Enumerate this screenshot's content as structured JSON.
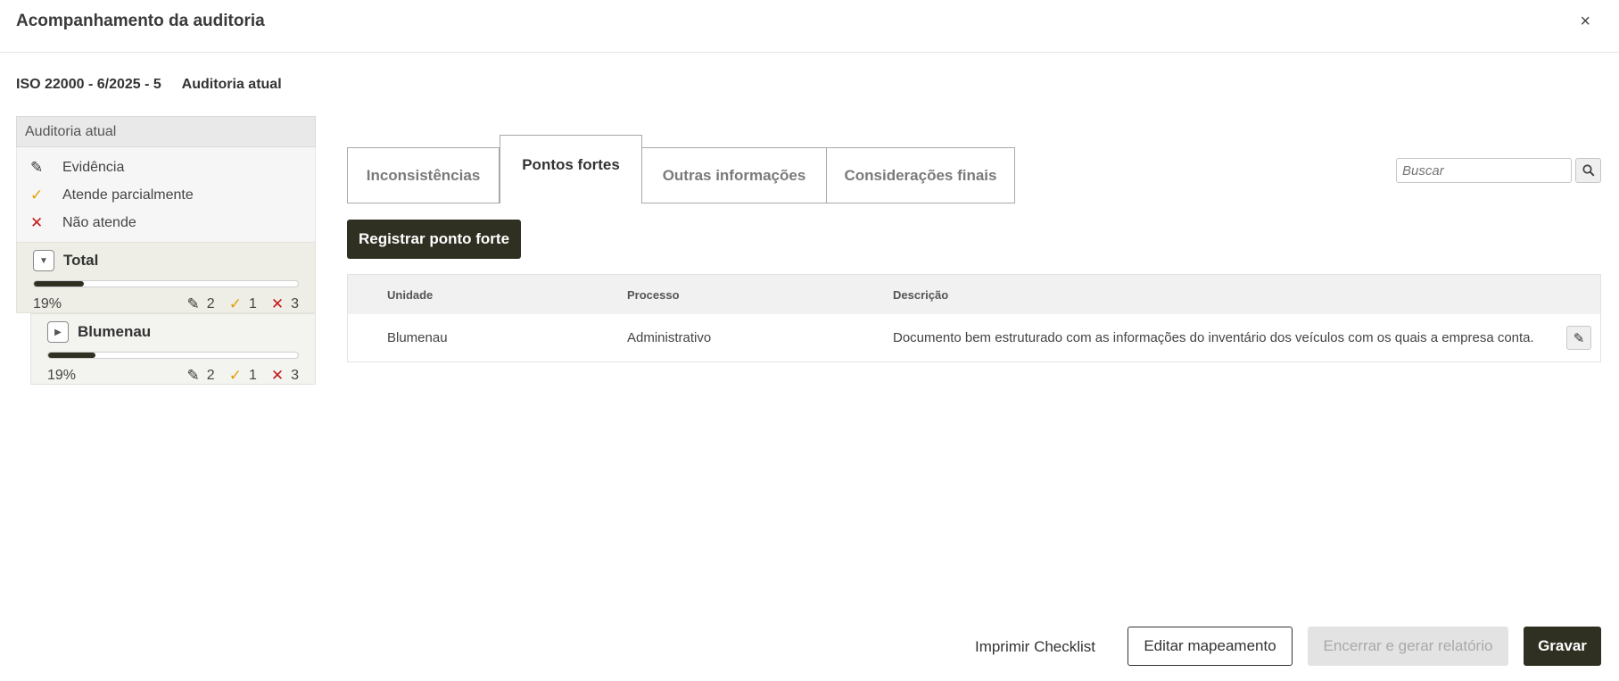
{
  "header": {
    "title": "Acompanhamento da auditoria",
    "close_label": "×"
  },
  "audit": {
    "code": "ISO 22000 - 6/2025 - 5",
    "label": "Auditoria atual"
  },
  "sidebar": {
    "heading": "Auditoria atual",
    "legend": [
      {
        "icon": "pencil-icon",
        "label": "Evidência"
      },
      {
        "icon": "check-icon",
        "label": "Atende parcialmente"
      },
      {
        "icon": "x-icon",
        "label": "Não atende"
      }
    ],
    "nodes": [
      {
        "label": "Total",
        "expanded": true,
        "progress": 0.19,
        "percent": "19%",
        "evidence": "2",
        "partial": "1",
        "fail": "3"
      },
      {
        "label": "Blumenau",
        "expanded": false,
        "progress": 0.19,
        "percent": "19%",
        "evidence": "2",
        "partial": "1",
        "fail": "3"
      }
    ]
  },
  "tabs": [
    {
      "label": "Inconsistências",
      "active": false
    },
    {
      "label": "Pontos fortes",
      "active": true
    },
    {
      "label": "Outras informações",
      "active": false
    },
    {
      "label": "Considerações finais",
      "active": false
    }
  ],
  "search": {
    "placeholder": "Buscar"
  },
  "register_button": "Registrar ponto forte",
  "table": {
    "columns": [
      "Unidade",
      "Processo",
      "Descrição"
    ],
    "rows": [
      {
        "unidade": "Blumenau",
        "processo": "Administrativo",
        "descricao": "Documento bem estruturado com as informações do inventário dos veículos com os quais a empresa conta."
      }
    ]
  },
  "footer": {
    "print": "Imprimir Checklist",
    "edit_mapping": "Editar mapeamento",
    "close_report": "Encerrar e gerar relatório",
    "save": "Gravar"
  },
  "colors": {
    "accent": "#2f3022",
    "partial": "#e0a100",
    "fail": "#c41a1a"
  }
}
